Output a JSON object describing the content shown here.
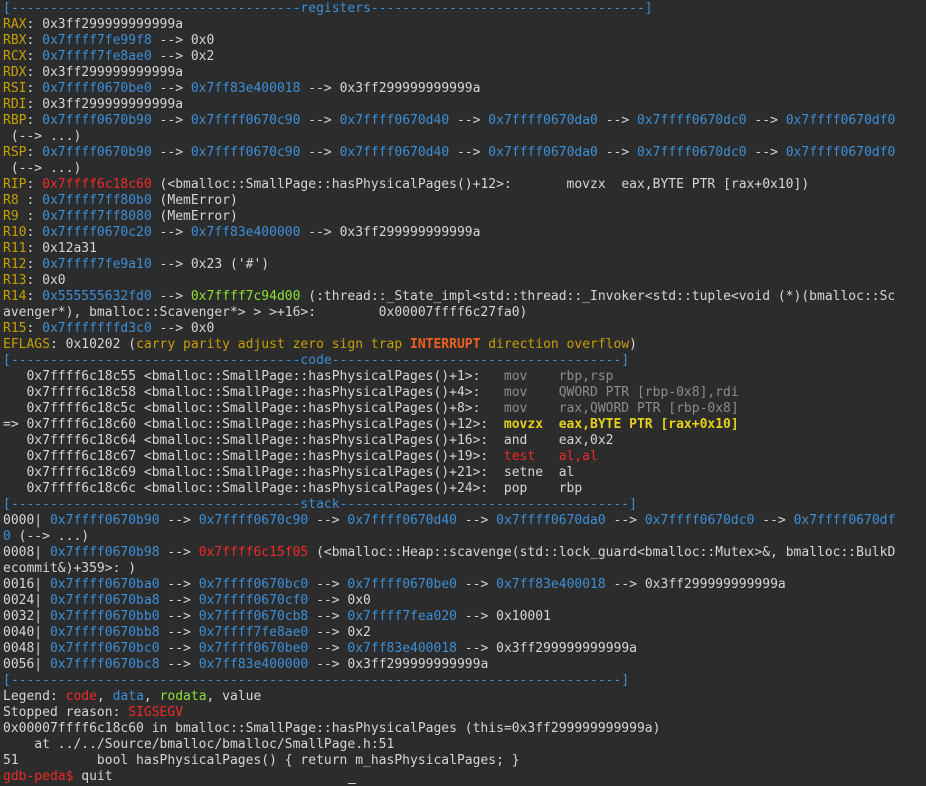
{
  "terminal": {
    "lines": [
      [
        [
          "c-blue",
          "[-------------------------------------registers-----------------------------------]"
        ]
      ],
      [
        [
          "c-yellow",
          "RAX"
        ],
        [
          "c-white",
          ": 0x3ff299999999999a"
        ]
      ],
      [
        [
          "c-yellow",
          "RBX"
        ],
        [
          "c-white",
          ": "
        ],
        [
          "c-blue",
          "0x7ffff7fe99f8"
        ],
        [
          "c-white",
          " --> 0x0"
        ]
      ],
      [
        [
          "c-yellow",
          "RCX"
        ],
        [
          "c-white",
          ": "
        ],
        [
          "c-blue",
          "0x7ffff7fe8ae0"
        ],
        [
          "c-white",
          " --> 0x2"
        ]
      ],
      [
        [
          "c-yellow",
          "RDX"
        ],
        [
          "c-white",
          ": 0x3ff299999999999a"
        ]
      ],
      [
        [
          "c-yellow",
          "RSI"
        ],
        [
          "c-white",
          ": "
        ],
        [
          "c-blue",
          "0x7ffff0670be0"
        ],
        [
          "c-white",
          " --> "
        ],
        [
          "c-blue",
          "0x7ff83e400018"
        ],
        [
          "c-white",
          " --> 0x3ff299999999999a"
        ]
      ],
      [
        [
          "c-yellow",
          "RDI"
        ],
        [
          "c-white",
          ": 0x3ff299999999999a"
        ]
      ],
      [
        [
          "c-yellow",
          "RBP"
        ],
        [
          "c-white",
          ": "
        ],
        [
          "c-blue",
          "0x7ffff0670b90"
        ],
        [
          "c-white",
          " --> "
        ],
        [
          "c-blue",
          "0x7ffff0670c90"
        ],
        [
          "c-white",
          " --> "
        ],
        [
          "c-blue",
          "0x7ffff0670d40"
        ],
        [
          "c-white",
          " --> "
        ],
        [
          "c-blue",
          "0x7ffff0670da0"
        ],
        [
          "c-white",
          " --> "
        ],
        [
          "c-blue",
          "0x7ffff0670dc0"
        ],
        [
          "c-white",
          " --> "
        ],
        [
          "c-blue",
          "0x7ffff0670df0"
        ]
      ],
      [
        [
          "c-white",
          " (--> ...)"
        ]
      ],
      [
        [
          "c-yellow",
          "RSP"
        ],
        [
          "c-white",
          ": "
        ],
        [
          "c-blue",
          "0x7ffff0670b90"
        ],
        [
          "c-white",
          " --> "
        ],
        [
          "c-blue",
          "0x7ffff0670c90"
        ],
        [
          "c-white",
          " --> "
        ],
        [
          "c-blue",
          "0x7ffff0670d40"
        ],
        [
          "c-white",
          " --> "
        ],
        [
          "c-blue",
          "0x7ffff0670da0"
        ],
        [
          "c-white",
          " --> "
        ],
        [
          "c-blue",
          "0x7ffff0670dc0"
        ],
        [
          "c-white",
          " --> "
        ],
        [
          "c-blue",
          "0x7ffff0670df0"
        ]
      ],
      [
        [
          "c-white",
          " (--> ...)"
        ]
      ],
      [
        [
          "c-yellow",
          "RIP"
        ],
        [
          "c-white",
          ": "
        ],
        [
          "c-red",
          "0x7ffff6c18c60"
        ],
        [
          "c-white",
          " (<bmalloc::SmallPage::hasPhysicalPages()+12>:       movzx  eax,BYTE PTR [rax+0x10])"
        ]
      ],
      [
        [
          "c-yellow",
          "R8 "
        ],
        [
          "c-white",
          ": "
        ],
        [
          "c-blue",
          "0x7ffff7ff80b0"
        ],
        [
          "c-white",
          " (MemError)"
        ]
      ],
      [
        [
          "c-yellow",
          "R9 "
        ],
        [
          "c-white",
          ": "
        ],
        [
          "c-blue",
          "0x7ffff7ff8080"
        ],
        [
          "c-white",
          " (MemError)"
        ]
      ],
      [
        [
          "c-yellow",
          "R10"
        ],
        [
          "c-white",
          ": "
        ],
        [
          "c-blue",
          "0x7ffff0670c20"
        ],
        [
          "c-white",
          " --> "
        ],
        [
          "c-blue",
          "0x7ff83e400000"
        ],
        [
          "c-white",
          " --> 0x3ff299999999999a"
        ]
      ],
      [
        [
          "c-yellow",
          "R11"
        ],
        [
          "c-white",
          ": 0x12a31"
        ]
      ],
      [
        [
          "c-yellow",
          "R12"
        ],
        [
          "c-white",
          ": "
        ],
        [
          "c-blue",
          "0x7ffff7fe9a10"
        ],
        [
          "c-white",
          " --> 0x23 ('#')"
        ]
      ],
      [
        [
          "c-yellow",
          "R13"
        ],
        [
          "c-white",
          ": 0x0"
        ]
      ],
      [
        [
          "c-yellow",
          "R14"
        ],
        [
          "c-white",
          ": "
        ],
        [
          "c-blue",
          "0x555555632fd0"
        ],
        [
          "c-white",
          " --> "
        ],
        [
          "c-green",
          "0x7ffff7c94d00"
        ],
        [
          "c-white",
          " (:thread::_State_impl<std::thread::_Invoker<std::tuple<void (*)(bmalloc::Sc"
        ]
      ],
      [
        [
          "c-white",
          "avenger*), bmalloc::Scavenger*> > >+16>:        0x00007ffff6c27fa0)"
        ]
      ],
      [
        [
          "c-yellow",
          "R15"
        ],
        [
          "c-white",
          ": "
        ],
        [
          "c-blue",
          "0x7fffffffd3c0"
        ],
        [
          "c-white",
          " --> 0x0"
        ]
      ],
      [
        [
          "c-yellow",
          "EFLAGS"
        ],
        [
          "c-white",
          ": 0x10202 ("
        ],
        [
          "c-yellow",
          "carry parity adjust zero sign trap "
        ],
        [
          "c-bold-red",
          "INTERRUPT"
        ],
        [
          "c-yellow",
          " direction overflow"
        ],
        [
          "c-white",
          ")"
        ]
      ],
      [
        [
          "c-blue",
          "[-------------------------------------code-------------------------------------]"
        ]
      ],
      [
        [
          "c-white",
          "   0x7ffff6c18c55 <bmalloc::SmallPage::hasPhysicalPages()+1>:   "
        ],
        [
          "c-gray",
          "mov    rbp,rsp"
        ]
      ],
      [
        [
          "c-white",
          "   0x7ffff6c18c58 <bmalloc::SmallPage::hasPhysicalPages()+4>:   "
        ],
        [
          "c-gray",
          "mov    QWORD PTR [rbp-0x8],rdi"
        ]
      ],
      [
        [
          "c-white",
          "   0x7ffff6c18c5c <bmalloc::SmallPage::hasPhysicalPages()+8>:   "
        ],
        [
          "c-gray",
          "mov    rax,QWORD PTR [rbp-0x8]"
        ]
      ],
      [
        [
          "c-white",
          "=> 0x7ffff6c18c60 <bmalloc::SmallPage::hasPhysicalPages()+12>:  "
        ],
        [
          "c-bold-yellow",
          "movzx  eax,BYTE PTR [rax+0x10]"
        ]
      ],
      [
        [
          "c-white",
          "   0x7ffff6c18c64 <bmalloc::SmallPage::hasPhysicalPages()+16>:  and    eax,0x2"
        ]
      ],
      [
        [
          "c-white",
          "   0x7ffff6c18c67 <bmalloc::SmallPage::hasPhysicalPages()+19>:  "
        ],
        [
          "c-red",
          "test   al,al"
        ]
      ],
      [
        [
          "c-white",
          "   0x7ffff6c18c69 <bmalloc::SmallPage::hasPhysicalPages()+21>:  setne  al"
        ]
      ],
      [
        [
          "c-white",
          "   0x7ffff6c18c6c <bmalloc::SmallPage::hasPhysicalPages()+24>:  pop    rbp"
        ]
      ],
      [
        [
          "c-blue",
          "[-------------------------------------stack-------------------------------------]"
        ]
      ],
      [
        [
          "c-white",
          "0000| "
        ],
        [
          "c-blue",
          "0x7ffff0670b90"
        ],
        [
          "c-white",
          " --> "
        ],
        [
          "c-blue",
          "0x7ffff0670c90"
        ],
        [
          "c-white",
          " --> "
        ],
        [
          "c-blue",
          "0x7ffff0670d40"
        ],
        [
          "c-white",
          " --> "
        ],
        [
          "c-blue",
          "0x7ffff0670da0"
        ],
        [
          "c-white",
          " --> "
        ],
        [
          "c-blue",
          "0x7ffff0670dc0"
        ],
        [
          "c-white",
          " --> "
        ],
        [
          "c-blue",
          "0x7ffff0670df"
        ]
      ],
      [
        [
          "c-blue",
          "0"
        ],
        [
          "c-white",
          " (--> ...)"
        ]
      ],
      [
        [
          "c-white",
          "0008| "
        ],
        [
          "c-blue",
          "0x7ffff0670b98"
        ],
        [
          "c-white",
          " --> "
        ],
        [
          "c-red",
          "0x7ffff6c15f05"
        ],
        [
          "c-white",
          " (<bmalloc::Heap::scavenge(std::lock_guard<bmalloc::Mutex>&, bmalloc::BulkD"
        ]
      ],
      [
        [
          "c-white",
          "ecommit&)+359>: )"
        ]
      ],
      [
        [
          "c-white",
          "0016| "
        ],
        [
          "c-blue",
          "0x7ffff0670ba0"
        ],
        [
          "c-white",
          " --> "
        ],
        [
          "c-blue",
          "0x7ffff0670bc0"
        ],
        [
          "c-white",
          " --> "
        ],
        [
          "c-blue",
          "0x7ffff0670be0"
        ],
        [
          "c-white",
          " --> "
        ],
        [
          "c-blue",
          "0x7ff83e400018"
        ],
        [
          "c-white",
          " --> 0x3ff299999999999a"
        ]
      ],
      [
        [
          "c-white",
          "0024| "
        ],
        [
          "c-blue",
          "0x7ffff0670ba8"
        ],
        [
          "c-white",
          " --> "
        ],
        [
          "c-blue",
          "0x7ffff0670cf0"
        ],
        [
          "c-white",
          " --> 0x0"
        ]
      ],
      [
        [
          "c-white",
          "0032| "
        ],
        [
          "c-blue",
          "0x7ffff0670bb0"
        ],
        [
          "c-white",
          " --> "
        ],
        [
          "c-blue",
          "0x7ffff0670cb8"
        ],
        [
          "c-white",
          " --> "
        ],
        [
          "c-blue",
          "0x7ffff7fea020"
        ],
        [
          "c-white",
          " --> 0x10001"
        ]
      ],
      [
        [
          "c-white",
          "0040| "
        ],
        [
          "c-blue",
          "0x7ffff0670bb8"
        ],
        [
          "c-white",
          " --> "
        ],
        [
          "c-blue",
          "0x7ffff7fe8ae0"
        ],
        [
          "c-white",
          " --> 0x2"
        ]
      ],
      [
        [
          "c-white",
          "0048| "
        ],
        [
          "c-blue",
          "0x7ffff0670bc0"
        ],
        [
          "c-white",
          " --> "
        ],
        [
          "c-blue",
          "0x7ffff0670be0"
        ],
        [
          "c-white",
          " --> "
        ],
        [
          "c-blue",
          "0x7ff83e400018"
        ],
        [
          "c-white",
          " --> 0x3ff299999999999a"
        ]
      ],
      [
        [
          "c-white",
          "0056| "
        ],
        [
          "c-blue",
          "0x7ffff0670bc8"
        ],
        [
          "c-white",
          " --> "
        ],
        [
          "c-blue",
          "0x7ff83e400000"
        ],
        [
          "c-white",
          " --> 0x3ff299999999999a"
        ]
      ],
      [
        [
          "c-blue",
          "[------------------------------------------------------------------------------]"
        ]
      ],
      [
        [
          "c-white",
          "Legend: "
        ],
        [
          "c-red",
          "code"
        ],
        [
          "c-white",
          ", "
        ],
        [
          "c-blue",
          "data"
        ],
        [
          "c-white",
          ", "
        ],
        [
          "c-green",
          "rodata"
        ],
        [
          "c-white",
          ", value"
        ]
      ],
      [
        [
          "c-white",
          "Stopped reason: "
        ],
        [
          "c-red",
          "SIGSEGV"
        ]
      ],
      [
        [
          "c-white",
          "0x00007ffff6c18c60 in bmalloc::SmallPage::hasPhysicalPages (this=0x3ff299999999999a)"
        ]
      ],
      [
        [
          "c-white",
          "    at ../../Source/bmalloc/bmalloc/SmallPage.h:51"
        ]
      ],
      [
        [
          "c-white",
          "51          bool hasPhysicalPages() { return m_hasPhysicalPages; }"
        ]
      ],
      [
        [
          "c-prompt",
          "gdb-peda$ "
        ],
        [
          "c-white",
          "quit"
        ]
      ]
    ]
  }
}
